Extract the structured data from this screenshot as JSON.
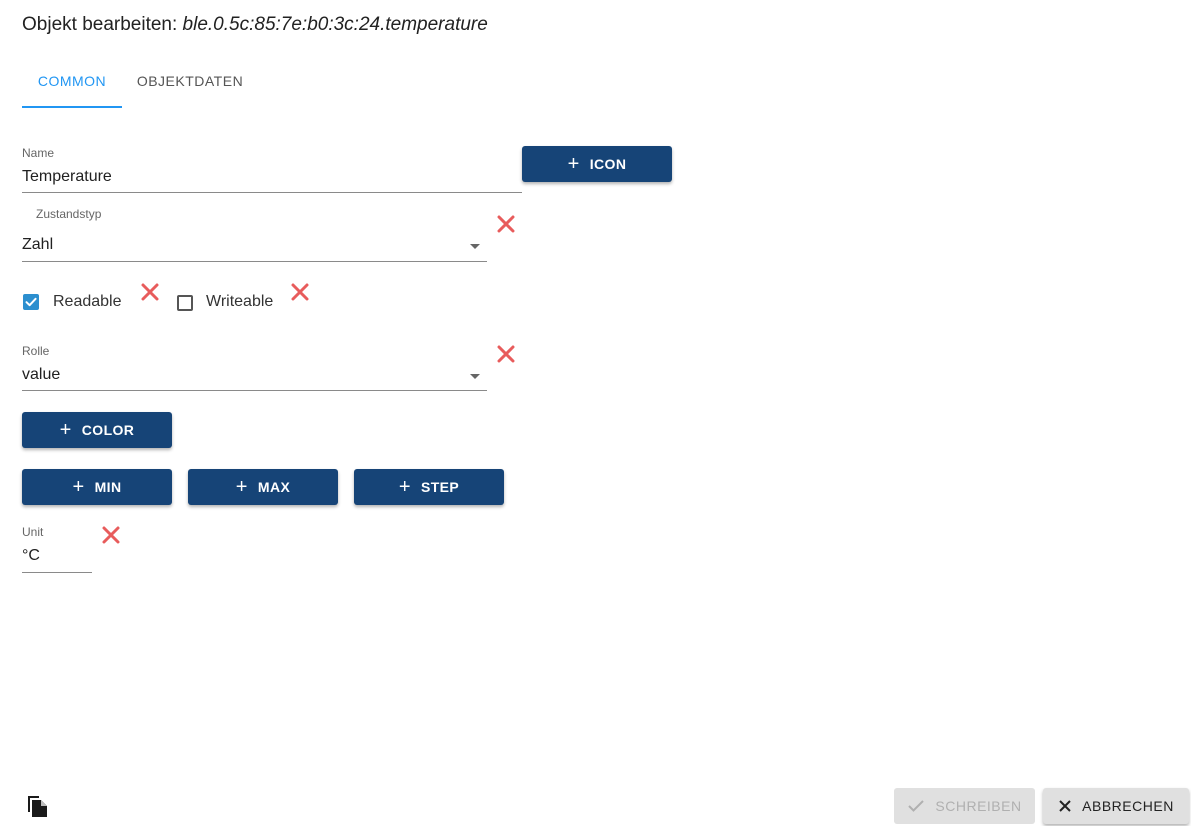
{
  "dialog": {
    "title_prefix": "Objekt bearbeiten:",
    "object_id": "ble.0.5c:85:7e:b0:3c:24.temperature"
  },
  "tabs": [
    {
      "label": "COMMON",
      "active": true
    },
    {
      "label": "OBJEKTDATEN",
      "active": false
    }
  ],
  "fields": {
    "name": {
      "label": "Name",
      "value": "Temperature"
    },
    "state_type": {
      "label": "Zustandstyp",
      "value": "Zahl"
    },
    "role": {
      "label": "Rolle",
      "value": "value"
    },
    "unit": {
      "label": "Unit",
      "value": "°C"
    }
  },
  "checkboxes": {
    "readable": {
      "label": "Readable",
      "checked": true
    },
    "writeable": {
      "label": "Writeable",
      "checked": false
    }
  },
  "buttons": {
    "icon": "ICON",
    "color": "COLOR",
    "min": "MIN",
    "max": "MAX",
    "step": "STEP",
    "plus_glyph": "+"
  },
  "footer": {
    "save_label": "SCHREIBEN",
    "cancel_label": "ABBRECHEN",
    "copy_icon": "copy-icon"
  },
  "colors": {
    "accent": "#2196f3",
    "button_bg": "#164477",
    "delete_x": "#e85c5c",
    "checkbox": "#2c8fcf"
  }
}
